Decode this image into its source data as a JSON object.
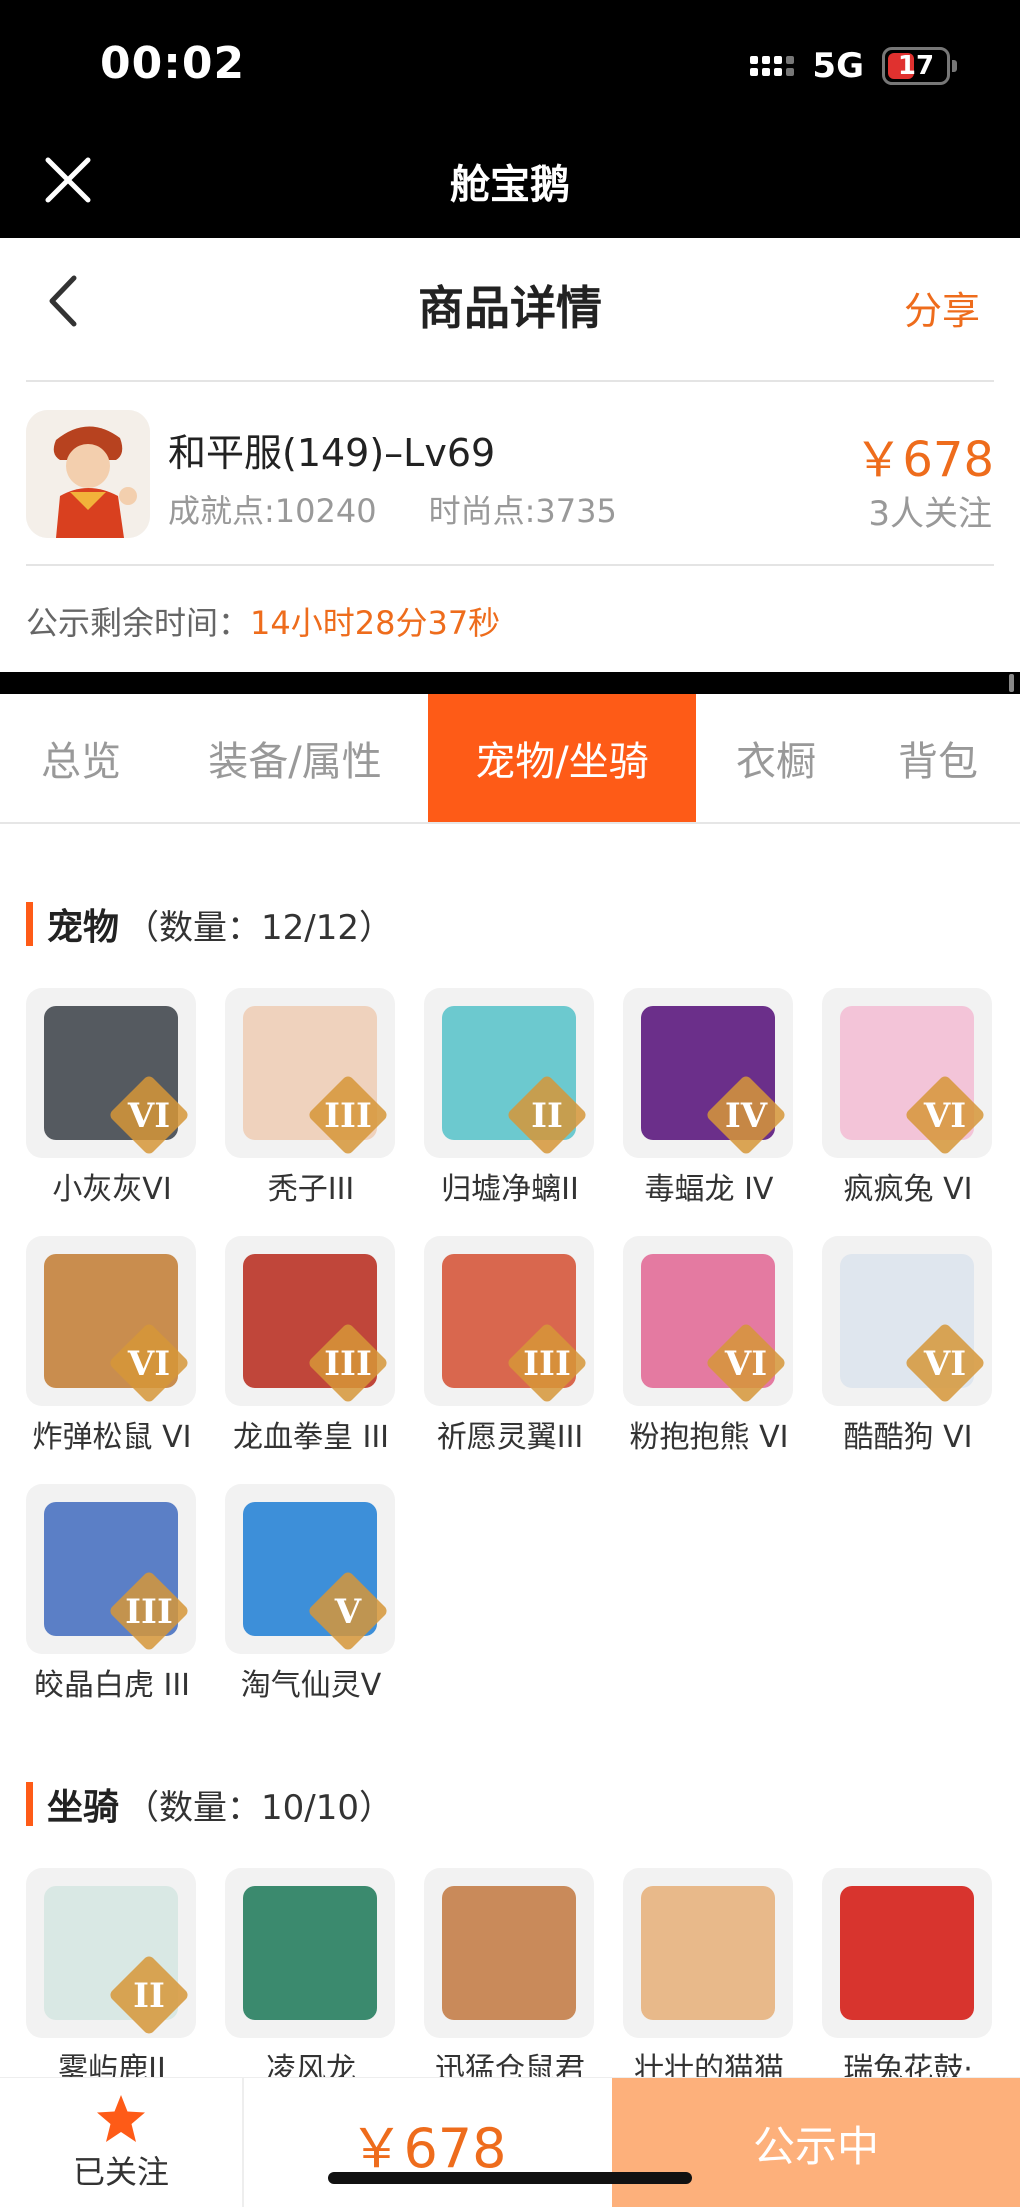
{
  "status_bar": {
    "time": "00:02",
    "network": "5G",
    "battery": "17"
  },
  "app_bar": {
    "title": "舱宝鹅"
  },
  "header": {
    "title": "商品详情",
    "share": "分享"
  },
  "product": {
    "name": "和平服(149)–Lv69",
    "achievement": "成就点:10240",
    "fashion": "时尚点:3735",
    "price": "￥678",
    "followers": "3人关注"
  },
  "countdown": {
    "label": "公示剩余时间：",
    "value": "14小时28分37秒"
  },
  "tabs": [
    {
      "label": "总览"
    },
    {
      "label": "装备/属性"
    },
    {
      "label": "宠物/坐骑",
      "active": true
    },
    {
      "label": "衣橱"
    },
    {
      "label": "背包"
    }
  ],
  "pets": {
    "title": "宠物",
    "count": "（数量：12/12）",
    "items": [
      {
        "name": "小灰灰VI",
        "rank": "VI",
        "color": "#555a60"
      },
      {
        "name": "秃子III",
        "rank": "III",
        "color": "#efd2bd"
      },
      {
        "name": "归墟净螭II",
        "rank": "II",
        "color": "#6cc9cf"
      },
      {
        "name": "毒蝠龙 IV",
        "rank": "IV",
        "color": "#6b2f8a"
      },
      {
        "name": "疯疯兔 VI",
        "rank": "VI",
        "color": "#f3c4d8"
      },
      {
        "name": "炸弹松鼠 VI",
        "rank": "VI",
        "color": "#c98d4e"
      },
      {
        "name": "龙血拳皇 III",
        "rank": "III",
        "color": "#c0463a"
      },
      {
        "name": "祈愿灵翼III",
        "rank": "III",
        "color": "#d9674e"
      },
      {
        "name": "粉抱抱熊 VI",
        "rank": "VI",
        "color": "#e47aa1"
      },
      {
        "name": "酷酷狗 VI",
        "rank": "VI",
        "color": "#dfe6ee"
      },
      {
        "name": "皎晶白虎 III",
        "rank": "III",
        "color": "#5b7fc6"
      },
      {
        "name": "淘气仙灵V",
        "rank": "V",
        "color": "#3d8fd9"
      }
    ]
  },
  "mounts": {
    "title": "坐骑",
    "count": "（数量：10/10）",
    "items": [
      {
        "name": "雾屿鹿II",
        "rank": "II",
        "color": "#d9e8e4"
      },
      {
        "name": "凌风龙",
        "rank": "",
        "color": "#3b8a6e"
      },
      {
        "name": "迅猛仓鼠君",
        "rank": "",
        "color": "#c98a5a"
      },
      {
        "name": "壮壮的猫猫",
        "rank": "",
        "color": "#e8b98a"
      },
      {
        "name": "瑞兔花鼓·",
        "rank": "",
        "color": "#d8342e"
      }
    ]
  },
  "bottom_bar": {
    "follow_label": "已关注",
    "price": "￥678",
    "status": "公示中"
  },
  "colors": {
    "accent": "#fe5b17",
    "price": "#ee6c1c",
    "status_button": "#fdb07b"
  }
}
